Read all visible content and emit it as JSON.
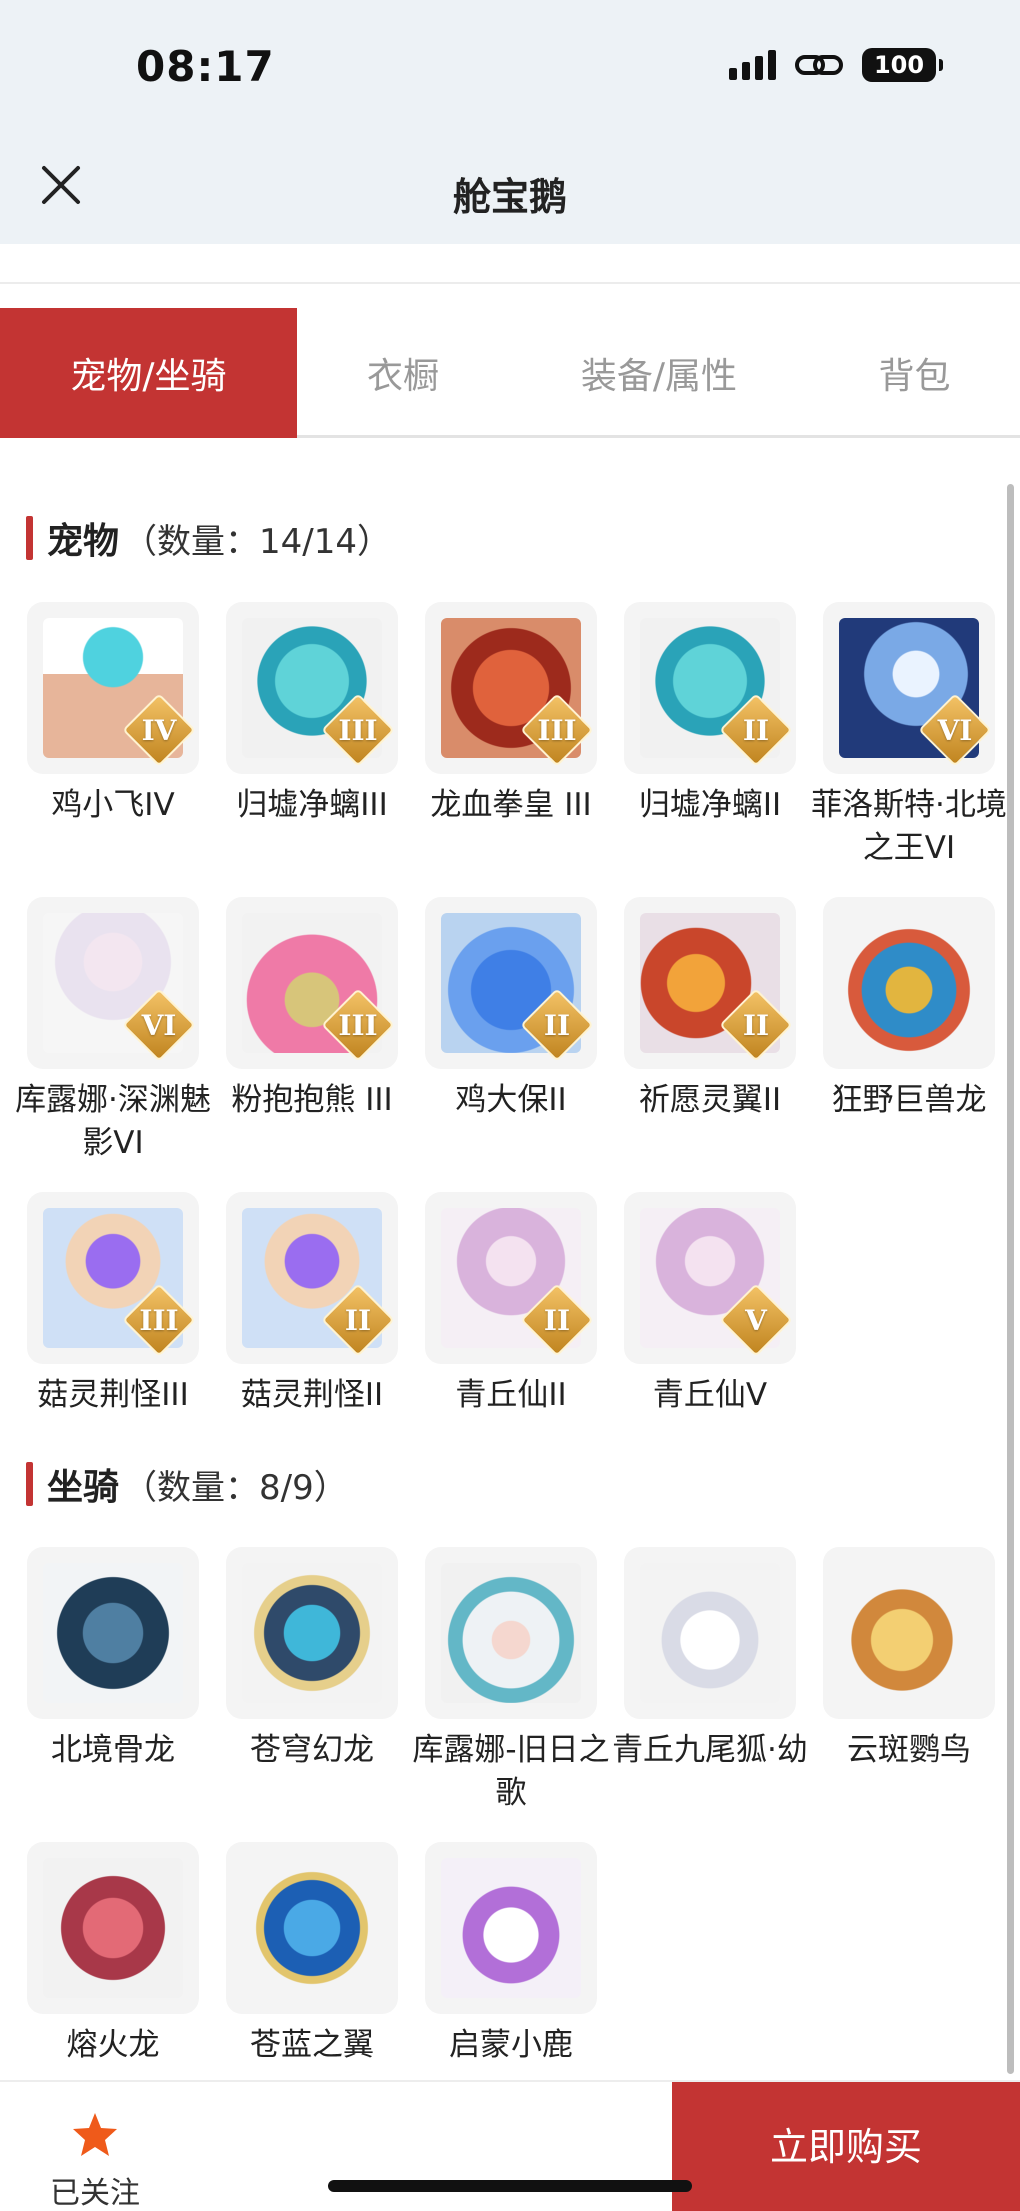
{
  "status_bar": {
    "time": "08:17",
    "battery": "100"
  },
  "nav": {
    "title": "舱宝鹅"
  },
  "tabs": [
    {
      "label": "宠物/坐骑",
      "active": true
    },
    {
      "label": "衣橱",
      "active": false
    },
    {
      "label": "装备/属性",
      "active": false
    },
    {
      "label": "背包",
      "active": false
    }
  ],
  "pets": {
    "title": "宠物",
    "count": "（数量：14/14）",
    "items": [
      {
        "name": "鸡小飞IV",
        "tier": "IV",
        "art": "chick-yellow"
      },
      {
        "name": "归墟净螭III",
        "tier": "III",
        "art": "dragon-teal"
      },
      {
        "name": "龙血拳皇 III",
        "tier": "III",
        "art": "beast-red"
      },
      {
        "name": "归墟净螭II",
        "tier": "II",
        "art": "dragon-teal"
      },
      {
        "name": "菲洛斯特·北境之王VI",
        "tier": "VI",
        "art": "ice-king"
      },
      {
        "name": "库露娜·深渊魅影VI",
        "tier": "VI",
        "art": "white-girl"
      },
      {
        "name": "粉抱抱熊 III",
        "tier": "III",
        "art": "pink-bear"
      },
      {
        "name": "鸡大保II",
        "tier": "II",
        "art": "blue-bird"
      },
      {
        "name": "祈愿灵翼II",
        "tier": "II",
        "art": "phoenix-orange"
      },
      {
        "name": "狂野巨兽龙",
        "tier": "",
        "art": "wild-dragon"
      },
      {
        "name": "菇灵荆怪III",
        "tier": "III",
        "art": "mushroom-purple"
      },
      {
        "name": "菇灵荆怪II",
        "tier": "II",
        "art": "mushroom-purple"
      },
      {
        "name": "青丘仙II",
        "tier": "II",
        "art": "fox-fairy"
      },
      {
        "name": "青丘仙V",
        "tier": "V",
        "art": "fox-fairy"
      }
    ]
  },
  "mounts": {
    "title": "坐骑",
    "count": "（数量：8/9）",
    "items": [
      {
        "name": "北境骨龙",
        "art": "bone-dragon"
      },
      {
        "name": "苍穹幻龙",
        "art": "sky-dragon"
      },
      {
        "name": "库露娜-旧日之歌",
        "art": "sheep-girl"
      },
      {
        "name": "青丘九尾狐·幼",
        "art": "white-fox"
      },
      {
        "name": "云斑鹦鸟",
        "art": "parrot"
      },
      {
        "name": "熔火龙",
        "art": "lava-dragon"
      },
      {
        "name": "苍蓝之翼",
        "art": "blue-wing"
      },
      {
        "name": "启蒙小鹿",
        "art": "white-deer"
      }
    ]
  },
  "bottom_bar": {
    "follow_label": "已关注",
    "buy_label": "立即购买"
  },
  "colors": {
    "accent": "#c33433",
    "follow_star": "#ef5a1a"
  }
}
